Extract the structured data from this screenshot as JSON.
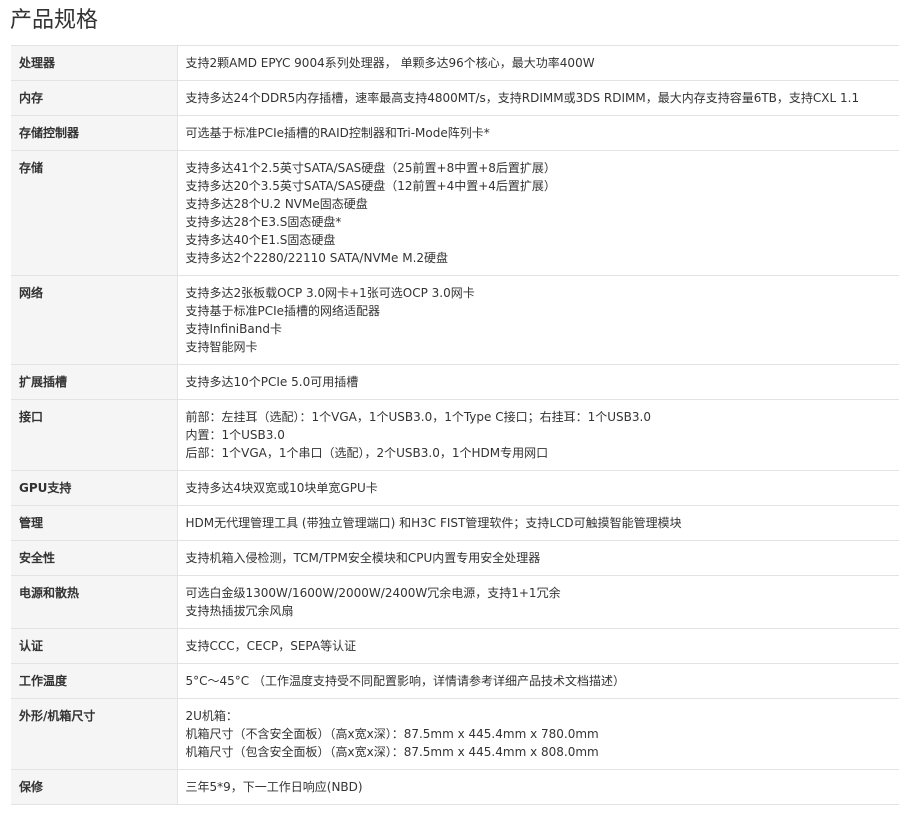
{
  "page": {
    "title": "产品规格"
  },
  "specs": [
    {
      "label": "处理器",
      "lines": [
        "支持2颗AMD EPYC 9004系列处理器， 单颗多达96个核心，最大功率400W"
      ]
    },
    {
      "label": "内存",
      "lines": [
        "支持多达24个DDR5内存插槽，速率最高支持4800MT/s，支持RDIMM或3DS RDIMM，最大内存支持容量6TB，支持CXL 1.1"
      ]
    },
    {
      "label": "存储控制器",
      "lines": [
        "可选基于标准PCIe插槽的RAID控制器和Tri-Mode阵列卡*"
      ]
    },
    {
      "label": "存储",
      "lines": [
        "支持多达41个2.5英寸SATA/SAS硬盘（25前置+8中置+8后置扩展）",
        "支持多达20个3.5英寸SATA/SAS硬盘（12前置+4中置+4后置扩展）",
        "支持多达28个U.2 NVMe固态硬盘",
        "支持多达28个E3.S固态硬盘*",
        "支持多达40个E1.S固态硬盘",
        "支持多达2个2280/22110 SATA/NVMe M.2硬盘"
      ]
    },
    {
      "label": "网络",
      "lines": [
        "支持多达2张板载OCP 3.0网卡+1张可选OCP 3.0网卡",
        "支持基于标准PCIe插槽的网络适配器",
        "支持InfiniBand卡",
        "支持智能网卡"
      ]
    },
    {
      "label": "扩展插槽",
      "lines": [
        "支持多达10个PCIe 5.0可用插槽"
      ]
    },
    {
      "label": "接口",
      "lines": [
        "前部：左挂耳（选配）：1个VGA，1个USB3.0，1个Type C接口；右挂耳：1个USB3.0",
        "内置：1个USB3.0",
        "后部：1个VGA，1个串口（选配），2个USB3.0，1个HDM专用网口"
      ]
    },
    {
      "label": "GPU支持",
      "lines": [
        "支持多达4块双宽或10块单宽GPU卡"
      ]
    },
    {
      "label": "管理",
      "lines": [
        "HDM无代理管理工具 (带独立管理端口) 和H3C FIST管理软件；支持LCD可触摸智能管理模块"
      ]
    },
    {
      "label": "安全性",
      "lines": [
        "支持机箱入侵检测，TCM/TPM安全模块和CPU内置专用安全处理器"
      ]
    },
    {
      "label": "电源和散热",
      "lines": [
        "可选白金级1300W/1600W/2000W/2400W冗余电源，支持1+1冗余",
        "支持热插拔冗余风扇"
      ]
    },
    {
      "label": "认证",
      "lines": [
        "支持CCC，CECP，SEPA等认证"
      ]
    },
    {
      "label": "工作温度",
      "lines": [
        "5°C～45°C （工作温度支持受不同配置影响，详情请参考详细产品技术文档描述）"
      ]
    },
    {
      "label": "外形/机箱尺寸",
      "lines": [
        "2U机箱：",
        "机箱尺寸（不含安全面板）（高x宽x深）：87.5mm x 445.4mm x 780.0mm",
        "机箱尺寸（包含安全面板）（高x宽x深）：87.5mm x 445.4mm x 808.0mm"
      ]
    },
    {
      "label": "保修",
      "lines": [
        "三年5*9，下一工作日响应(NBD)"
      ]
    }
  ]
}
